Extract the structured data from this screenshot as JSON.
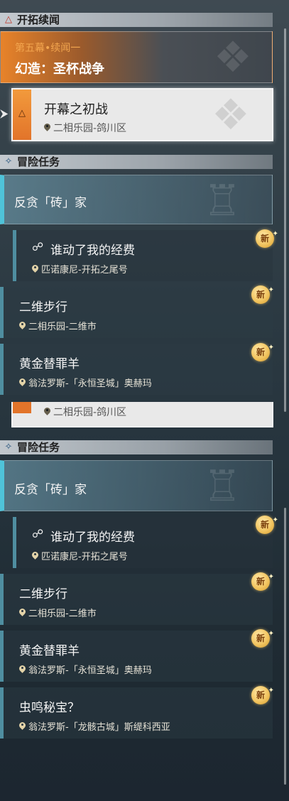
{
  "header1": {
    "title": "开拓续闻"
  },
  "story": {
    "chapter": "第五幕•续闻一",
    "title": "幻造：圣杯战争"
  },
  "selected_mission": {
    "title": "开幕之初战",
    "location": "二相乐园-鸽川区"
  },
  "header2": {
    "title": "冒险任务"
  },
  "adventure": [
    {
      "title": "反贪「砖」家"
    },
    {
      "title": "谁动了我的经费",
      "location": "匹诺康尼-开拓之尾号",
      "badge": "新"
    },
    {
      "title": "二维步行",
      "location": "二相乐园-二维市",
      "badge": "新"
    },
    {
      "title": "黄金替罪羊",
      "location": "翁法罗斯-「永恒圣城」奥赫玛",
      "badge": "新"
    }
  ],
  "partial_location": "二相乐园-鸽川区",
  "header3": {
    "title": "冒险任务"
  },
  "adventure2": [
    {
      "title": "反贪「砖」家"
    },
    {
      "title": "谁动了我的经费",
      "location": "匹诺康尼-开拓之尾号",
      "badge": "新"
    },
    {
      "title": "二维步行",
      "location": "二相乐园-二维市",
      "badge": "新"
    },
    {
      "title": "黄金替罪羊",
      "location": "翁法罗斯-「永恒圣城」奥赫玛",
      "badge": "新"
    },
    {
      "title": "虫鸣秘宝？",
      "location": "翁法罗斯-「龙骸古城」斯缇科西亚",
      "badge": "新"
    }
  ],
  "colors": {
    "accent_orange": "#e8832a",
    "accent_cyan": "#4fc3d9",
    "chapter_text": "#f0a54a",
    "badge": "#f2c561"
  }
}
